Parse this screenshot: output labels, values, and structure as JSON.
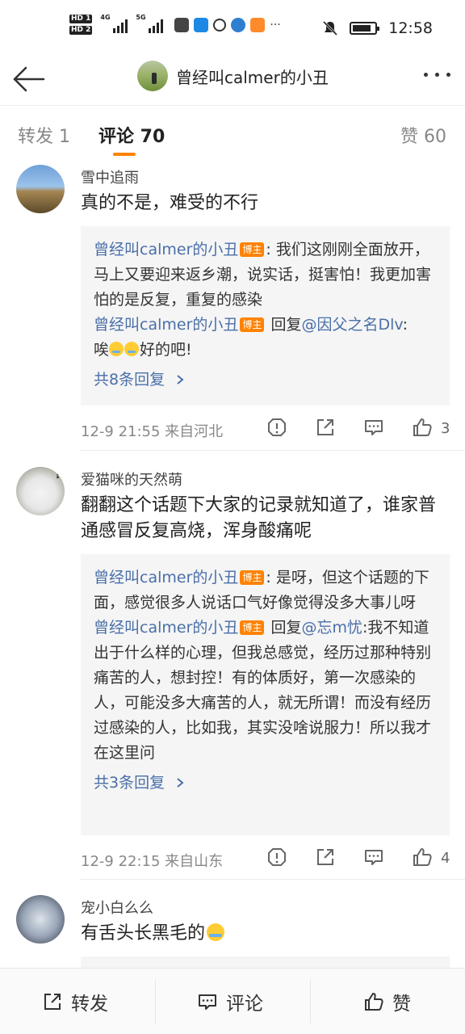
{
  "status_bar": {
    "hd1": "HD 1",
    "hd2": "HD 2",
    "net1": "4G",
    "net2": "5G",
    "time": "12:58",
    "battery_level": 0.85
  },
  "header": {
    "title": "曾经叫calmer的小丑"
  },
  "tabs": {
    "repost": "转发 1",
    "comments": "评论 70",
    "likes": "赞 60"
  },
  "comments": [
    {
      "username": "雪中追雨",
      "text": "真的不是，难受的不行",
      "replies": [
        {
          "author": "曾经叫calmer的小丑",
          "badge": "博主",
          "text": ": 我们这刚刚全面放开，马上又要迎来返乡潮，说实话，挺害怕！我更加害怕的是反复，重复的感染"
        },
        {
          "author": "曾经叫calmer的小丑",
          "badge": "博主",
          "reply_word": " 回复",
          "mention": "@因父之名Dlv",
          "text_before_emoji": ":",
          "text_line2_pre": "唉",
          "text_after": "好的吧!"
        }
      ],
      "more_replies": "共8条回复",
      "time_location": "12-9 21:55  来自河北",
      "likes": "3"
    },
    {
      "username": "爱猫咪的天然萌",
      "text": "翻翻这个话题下大家的记录就知道了，谁家普通感冒反复高烧，浑身酸痛呢",
      "replies": [
        {
          "author": "曾经叫calmer的小丑",
          "badge": "博主",
          "text": ": 是呀，但这个话题的下面，感觉很多人说话口气好像觉得没多大事儿呀"
        },
        {
          "author": "曾经叫calmer的小丑",
          "badge": "博主",
          "reply_word": " 回复",
          "mention": "@忘m忧",
          "text": ":我不知道出于什么样的心理，但我总感觉，经历过那种特别痛苦的人，想封控！有的体质好，第一次感染的人，可能没多大痛苦的人，就无所谓！而没有经历过感染的人，比如我，其实没啥说服力！所以我才在这里问"
        }
      ],
      "more_replies": "共3条回复",
      "time_location": "12-9 22:15  来自山东",
      "likes": "4"
    },
    {
      "username": "宠小白么么",
      "text": "有舌头长黑毛的"
    }
  ],
  "bottom_bar": {
    "repost": "转发",
    "comment": "评论",
    "like": "赞"
  }
}
